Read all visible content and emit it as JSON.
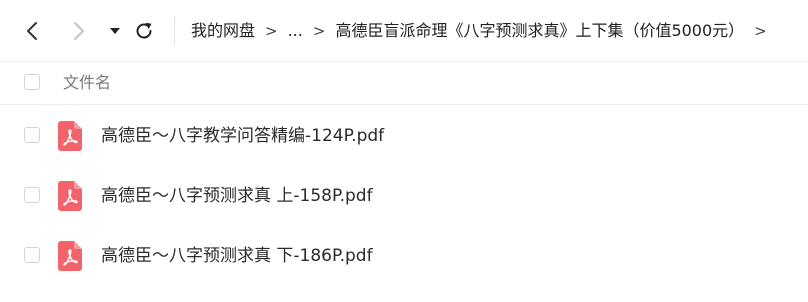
{
  "toolbar": {
    "back_icon": "chevron-left-icon",
    "forward_icon": "chevron-right-icon",
    "dropdown_icon": "caret-down-icon",
    "refresh_icon": "refresh-icon"
  },
  "breadcrumb": {
    "items": [
      {
        "label": "我的网盘"
      },
      {
        "label": "..."
      },
      {
        "label": "高德臣盲派命理《八字预测求真》上下集（价值5000元）"
      }
    ],
    "separator": ">"
  },
  "file_list": {
    "column_header": "文件名",
    "files": [
      {
        "name": "高德臣～八字教学问答精编-124P.pdf",
        "icon": "pdf-icon"
      },
      {
        "name": "高德臣～八字预测求真 上-158P.pdf",
        "icon": "pdf-icon"
      },
      {
        "name": "高德臣～八字预测求真 下-186P.pdf",
        "icon": "pdf-icon"
      }
    ]
  },
  "colors": {
    "pdf_icon": "#f2636b",
    "text": "#2b2b2b",
    "muted": "#7a7a7a"
  }
}
